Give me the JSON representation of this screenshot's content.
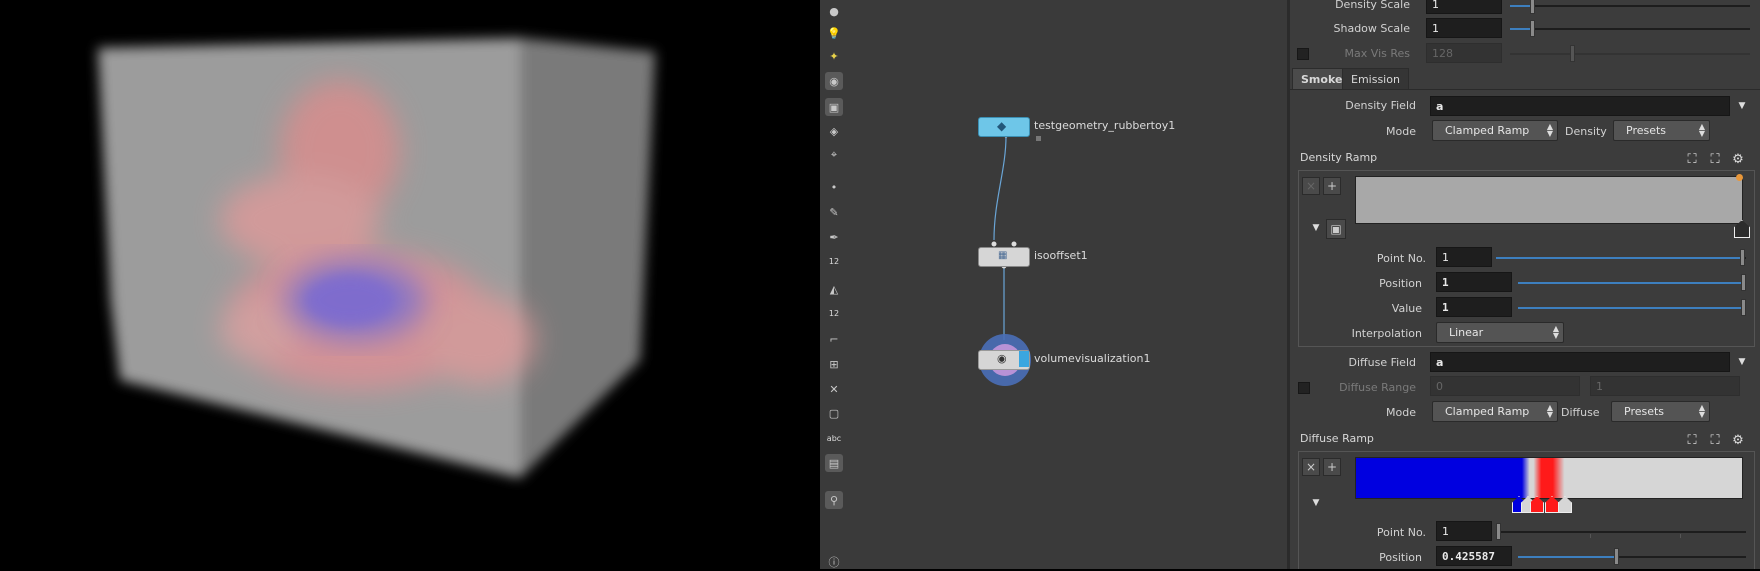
{
  "network": {
    "nodes": [
      {
        "label": "testgeometry_rubbertoy1"
      },
      {
        "label": "isooffset1"
      },
      {
        "label": "volumevisualization1"
      }
    ]
  },
  "toolbar": {
    "icons": [
      "sphere-icon",
      "light-bulb-icon",
      "light-icon",
      "camera-icon",
      "display-icon",
      "view-icon",
      "handle-icon",
      "point-icon",
      "brush-icon",
      "pen-icon",
      "number-icon",
      "paint-icon",
      "number-stack-icon",
      "corner-icon",
      "snap-icon",
      "pivot-icon",
      "box-icon",
      "text-icon",
      "image-icon",
      "pin-icon",
      "info-icon"
    ],
    "texts": {
      "n12a": "12",
      "n12b": "12",
      "abc": "abc"
    }
  },
  "params": {
    "density_scale": {
      "label": "Density Scale",
      "value": "1"
    },
    "shadow_scale": {
      "label": "Shadow Scale",
      "value": "1"
    },
    "max_vis_res": {
      "label": "Max Vis Res",
      "value": "128"
    },
    "tabs": [
      "Smoke",
      "Emission"
    ],
    "density_field": {
      "label": "Density Field",
      "value": "a"
    },
    "mode1": {
      "label": "Mode",
      "value": "Clamped Ramp",
      "right_label": "Density",
      "presets": "Presets"
    },
    "density_ramp": {
      "title": "Density Ramp",
      "point_no": {
        "label": "Point No.",
        "value": "1"
      },
      "position": {
        "label": "Position",
        "value": "1"
      },
      "value": {
        "label": "Value",
        "value": "1"
      },
      "interpolation": {
        "label": "Interpolation",
        "value": "Linear"
      }
    },
    "diffuse_field": {
      "label": "Diffuse Field",
      "value": "a"
    },
    "diffuse_range": {
      "label": "Diffuse Range",
      "min": "0",
      "max": "1"
    },
    "mode2": {
      "label": "Mode",
      "value": "Clamped Ramp",
      "right_label": "Diffuse",
      "presets": "Presets"
    },
    "diffuse_ramp": {
      "title": "Diffuse Ramp",
      "point_no": {
        "label": "Point No.",
        "value": "1"
      },
      "position": {
        "label": "Position",
        "value": "0.425587"
      }
    }
  },
  "colors": {
    "accent": "#3d7fbf",
    "node_blue": "#6ec6e8",
    "ramp_blue": "#0000e0",
    "ramp_red": "#ff1a1a"
  }
}
